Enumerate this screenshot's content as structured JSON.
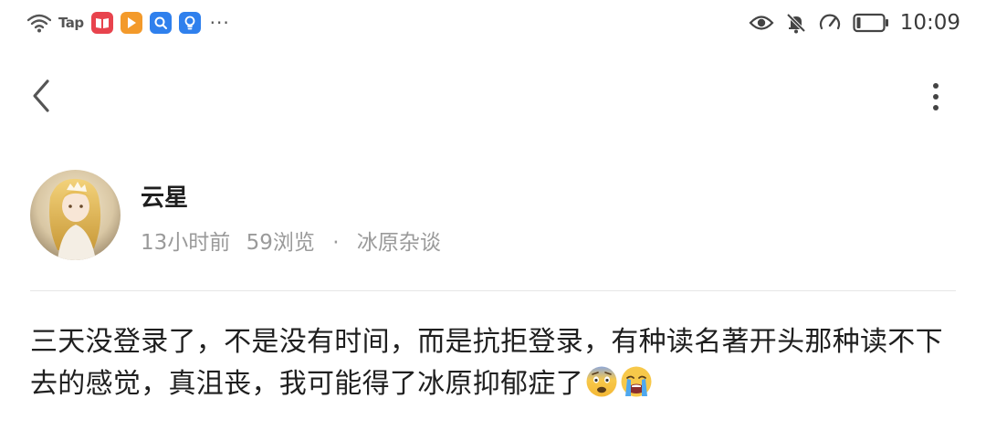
{
  "status_bar": {
    "carrier_label": "Tap",
    "time": "10:09",
    "more_indicator": "···",
    "icons": [
      "wifi-icon",
      "app-book-icon",
      "app-video-icon",
      "app-search-icon",
      "app-lightbulb-icon",
      "eye-icon",
      "bell-off-icon",
      "speed-gauge-icon",
      "battery-icon"
    ],
    "battery_level": 0.15
  },
  "nav": {
    "back_icon": "chevron-left-icon",
    "more_icon": "vertical-dots-icon"
  },
  "post": {
    "author": "云星",
    "time_ago": "13小时前",
    "views": "59浏览",
    "separator": "·",
    "forum": "冰原杂谈",
    "content": "三天没登录了，不是没有时间，而是抗拒登录，有种读名著开头那种读不下去的感觉，真沮丧，我可能得了冰原抑郁症了",
    "emojis": [
      "fearful-face-emoji",
      "crying-face-emoji"
    ]
  },
  "colors": {
    "text": "#1f1f1f",
    "meta": "#9a9a9a",
    "divider": "#e6e6e6"
  }
}
